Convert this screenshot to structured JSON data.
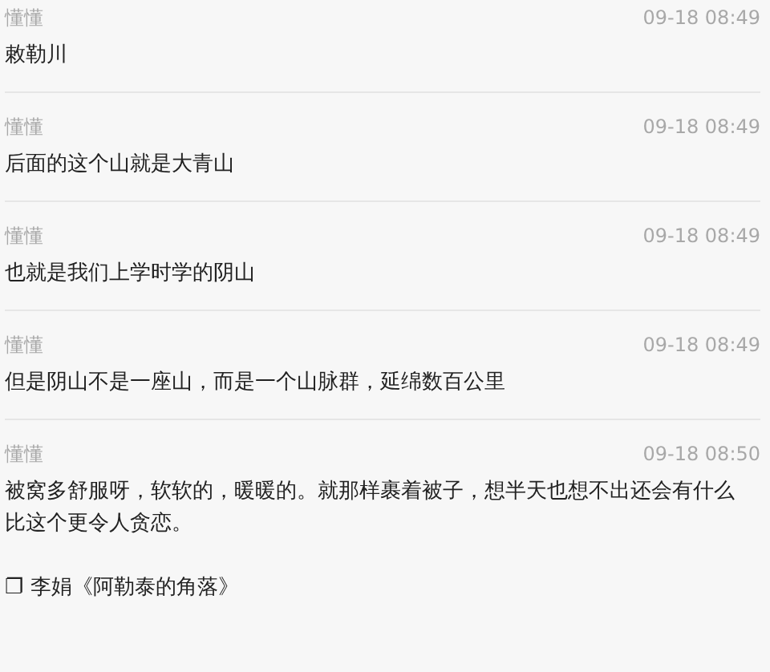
{
  "messages": [
    {
      "sender": "懂懂",
      "time": "09-18 08:49",
      "paragraphs": [
        "敕勒川"
      ]
    },
    {
      "sender": "懂懂",
      "time": "09-18 08:49",
      "paragraphs": [
        "后面的这个山就是大青山"
      ]
    },
    {
      "sender": "懂懂",
      "time": "09-18 08:49",
      "paragraphs": [
        "也就是我们上学时学的阴山"
      ]
    },
    {
      "sender": "懂懂",
      "time": "09-18 08:49",
      "paragraphs": [
        "但是阴山不是一座山，而是一个山脉群，延绵数百公里"
      ]
    },
    {
      "sender": "懂懂",
      "time": "09-18 08:50",
      "paragraphs": [
        "被窝多舒服呀，软软的，暖暖的。就那样裹着被子，想半天也想不出还会有什么比这个更令人贪恋。",
        "❐ 李娟《阿勒泰的角落》"
      ]
    }
  ]
}
